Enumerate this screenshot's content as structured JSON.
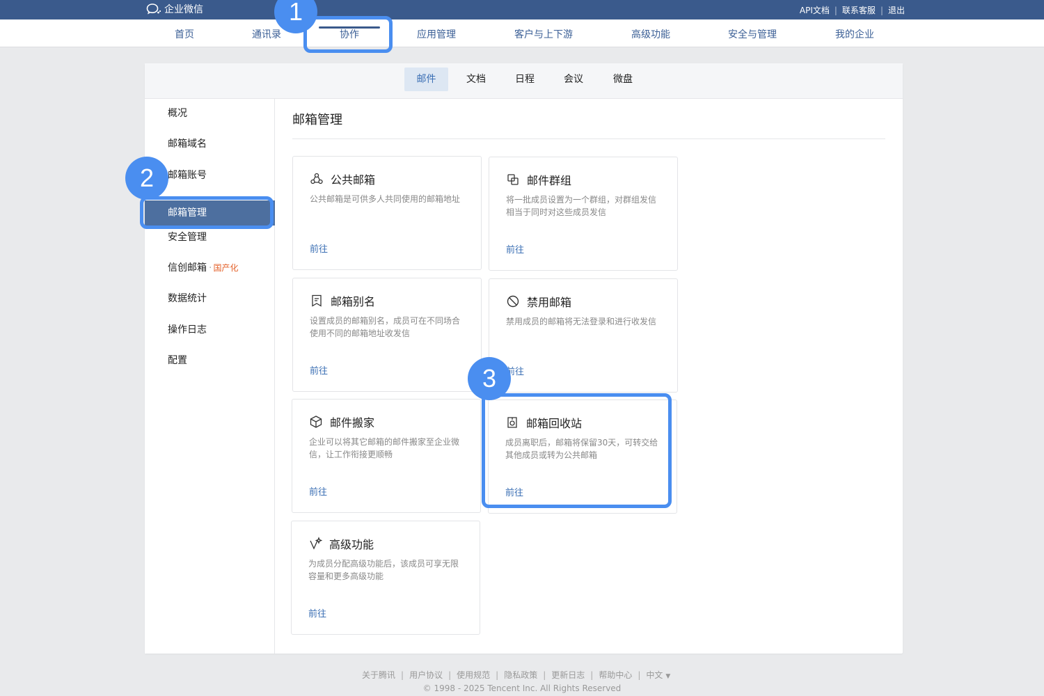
{
  "header": {
    "brand": "企业微信",
    "links": [
      "API文档",
      "联系客服",
      "退出"
    ]
  },
  "mainnav": {
    "items": [
      "首页",
      "通讯录",
      "协作",
      "应用管理",
      "客户与上下游",
      "高级功能",
      "安全与管理",
      "我的企业"
    ],
    "active": "协作"
  },
  "subnav": {
    "tabs": [
      "邮件",
      "文档",
      "日程",
      "会议",
      "微盘"
    ],
    "active": "邮件"
  },
  "sidebar": {
    "items": [
      "概况",
      "邮箱域名",
      "邮箱账号",
      "邮箱管理",
      "安全管理",
      "信创邮箱",
      "数据统计",
      "操作日志",
      "配置"
    ],
    "tag_sep": "·",
    "tag": "国产化",
    "active": "邮箱管理"
  },
  "content": {
    "title": "邮箱管理",
    "cards": [
      {
        "icon": "public-mailbox-icon",
        "title": "公共邮箱",
        "desc": "公共邮箱是可供多人共同使用的邮箱地址",
        "link": "前往"
      },
      {
        "icon": "mail-group-icon",
        "title": "邮件群组",
        "desc": "将一批成员设置为一个群组，对群组发信相当于同时对这些成员发信",
        "link": "前往"
      },
      {
        "icon": "mail-alias-icon",
        "title": "邮箱别名",
        "desc": "设置成员的邮箱别名，成员可在不同场合使用不同的邮箱地址收发信",
        "link": "前往"
      },
      {
        "icon": "disable-icon",
        "title": "禁用邮箱",
        "desc": "禁用成员的邮箱将无法登录和进行收发信",
        "link": "前往"
      },
      {
        "icon": "box-icon",
        "title": "邮件搬家",
        "desc": "企业可以将其它邮箱的邮件搬家至企业微信，让工作衔接更顺畅",
        "link": "前往"
      },
      {
        "icon": "recycle-bin-icon",
        "title": "邮箱回收站",
        "desc": "成员离职后，邮箱将保留30天，可转交给其他成员或转为公共邮箱",
        "link": "前往"
      },
      {
        "icon": "advanced-icon",
        "title": "高级功能",
        "desc": "为成员分配高级功能后，该成员可享无限容量和更多高级功能",
        "link": "前往"
      }
    ]
  },
  "annotations": [
    "1",
    "2",
    "3"
  ],
  "footer": {
    "links": [
      "关于腾讯",
      "用户协议",
      "使用规范",
      "隐私政策",
      "更新日志",
      "帮助中心",
      "中文"
    ],
    "caret": "▼",
    "copyright": "© 1998 - 2025 Tencent Inc. All Rights Reserved"
  },
  "colors": {
    "topbar": "#3a5a8c",
    "link": "#3b6fb4",
    "sidebar_active": "#4d6f9f",
    "annotation": "#4a8ef0",
    "tag": "#e4622b"
  }
}
